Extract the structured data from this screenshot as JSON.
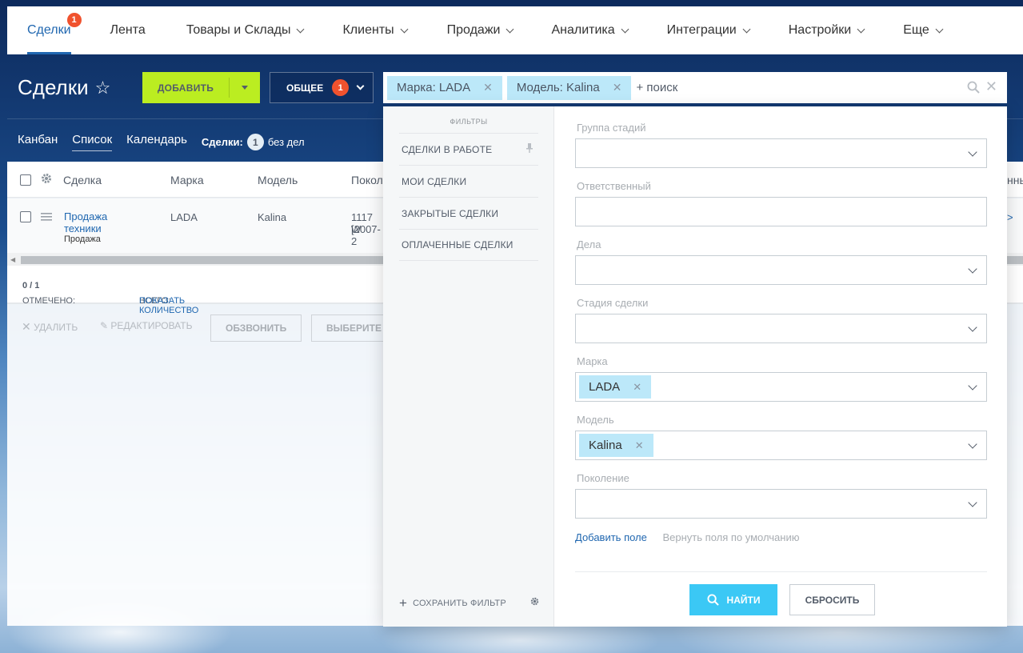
{
  "topnav": {
    "items": [
      {
        "label": "Сделки",
        "badge": "1",
        "active": true
      },
      {
        "label": "Лента"
      },
      {
        "label": "Товары и Склады"
      },
      {
        "label": "Клиенты"
      },
      {
        "label": "Продажи"
      },
      {
        "label": "Аналитика"
      },
      {
        "label": "Интеграции"
      },
      {
        "label": "Настройки"
      },
      {
        "label": "Еще"
      }
    ]
  },
  "header": {
    "title": "Сделки",
    "add_label": "ДОБАВИТЬ",
    "common_label": "ОБЩЕЕ",
    "common_badge": "1",
    "search": {
      "tags": [
        "Марка: LADA",
        "Модель: Kalina"
      ],
      "placeholder": "+ поиск"
    }
  },
  "views": {
    "kanban": "Канбан",
    "list": "Список",
    "calendar": "Календарь",
    "count_label": "Сделки:",
    "count": "1",
    "no_deals": "без дел"
  },
  "grid": {
    "columns": [
      "Сделка",
      "Марка",
      "Модель",
      "Покол"
    ],
    "col_right_fragment": "нны",
    "row": {
      "deal_line1": "Продажа",
      "deal_line2": "техники",
      "deal_type": "Продажа",
      "brand": "LADA",
      "model": "Kalina",
      "generation_line1": "1117 W",
      "generation_line2": "[2007-2",
      "right_fragment": ">"
    },
    "footer": {
      "marked_label": "ОТМЕЧЕНО:",
      "marked_value": "0 / 1",
      "total_label": "ВСЕГО:",
      "total_link": "ПОКАЗАТЬ КОЛИЧЕСТВО"
    },
    "actions": {
      "delete": "УДАЛИТЬ",
      "edit": "РЕДАКТИРОВАТЬ",
      "call": "ОБЗВОНИТЬ",
      "choose": "ВЫБЕРИТЕ Д"
    }
  },
  "filter": {
    "presets_title": "ФИЛЬТРЫ",
    "presets": [
      "СДЕЛКИ В РАБОТЕ",
      "МОИ СДЕЛКИ",
      "ЗАКРЫТЫЕ СДЕЛКИ",
      "ОПЛАЧЕННЫЕ СДЕЛКИ"
    ],
    "save_filter": "СОХРАНИТЬ ФИЛЬТР",
    "fields": [
      {
        "label": "Группа стадий",
        "type": "select",
        "value": ""
      },
      {
        "label": "Ответственный",
        "type": "input",
        "value": ""
      },
      {
        "label": "Дела",
        "type": "select",
        "value": ""
      },
      {
        "label": "Стадия сделки",
        "type": "select",
        "value": ""
      },
      {
        "label": "Марка",
        "type": "select",
        "tag": "LADA"
      },
      {
        "label": "Модель",
        "type": "select",
        "tag": "Kalina"
      },
      {
        "label": "Поколение",
        "type": "select",
        "value": ""
      }
    ],
    "add_field": "Добавить поле",
    "restore_fields": "Вернуть поля по умолчанию",
    "find_label": "НАЙТИ",
    "reset_label": "СБРОСИТЬ"
  },
  "colors": {
    "accent": "#2067b0",
    "add_button": "#bbed21",
    "find_button": "#3bc8f5",
    "badge": "#f0522e",
    "tag": "#bce8f9"
  }
}
